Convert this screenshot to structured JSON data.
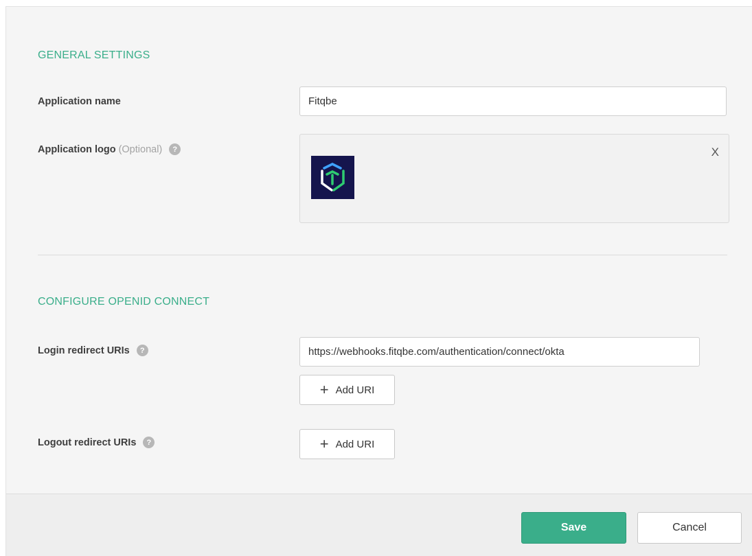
{
  "general": {
    "title": "GENERAL SETTINGS",
    "app_name_label": "Application name",
    "app_name_value": "Fitqbe",
    "app_logo_label": "Application logo",
    "app_logo_optional": "(Optional)",
    "help_glyph": "?",
    "remove_logo": "X"
  },
  "oidc": {
    "title": "CONFIGURE OPENID CONNECT",
    "login_label": "Login redirect URIs",
    "login_uri_value": "https://webhooks.fitqbe.com/authentication/connect/okta",
    "logout_label": "Logout redirect URIs",
    "add_uri_label": "Add URI",
    "plus_glyph": "+"
  },
  "footer": {
    "save_label": "Save",
    "cancel_label": "Cancel"
  },
  "colors": {
    "accent": "#3aae8a",
    "logo_bg": "#15154d"
  },
  "icons": [
    "help-icon",
    "plus-icon",
    "close-icon",
    "app-logo-icon"
  ]
}
